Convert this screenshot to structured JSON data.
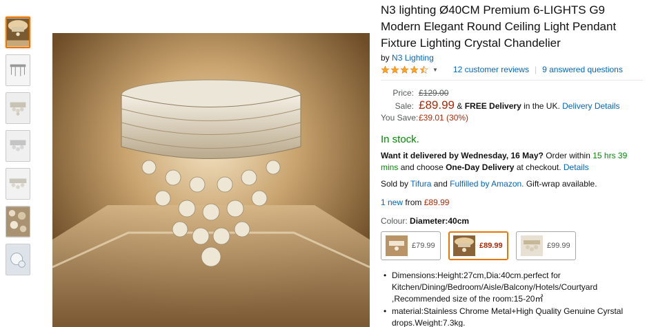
{
  "product": {
    "title": "N3 lighting Ø40CM Premium 6-LIGHTS G9 Modern Elegant Round Ceiling Light Pendant Fixture Lighting Crystal Chandelier",
    "by_label": "by",
    "brand": "N3 Lighting",
    "rating": {
      "stars": 4.5,
      "reviews_text": "12 customer reviews",
      "questions_text": "9 answered questions"
    }
  },
  "pricing": {
    "price_label": "Price:",
    "price": "£129.00",
    "sale_label": "Sale:",
    "sale_price": "£89.99",
    "delivery_prefix": "&",
    "free_delivery": "FREE Delivery",
    "delivery_suffix": "in the UK.",
    "delivery_details": "Delivery Details",
    "save_label": "You Save:",
    "save_value": "£39.01 (30%)"
  },
  "stock": "In stock.",
  "delivery_msg": {
    "want": "Want it delivered by Wednesday, 16 May?",
    "order_within": "Order within",
    "time": "15 hrs 39 mins",
    "choose": "and choose",
    "option": "One-Day Delivery",
    "at_checkout": "at checkout.",
    "details": "Details"
  },
  "seller": {
    "sold_by": "Sold by",
    "seller_name": "Tifura",
    "and": "and",
    "fulfilled": "Fulfilled by Amazon.",
    "gift": "Gift-wrap available."
  },
  "offers": {
    "new_link": "1 new",
    "from": "from",
    "price": "£89.99"
  },
  "colour": {
    "label": "Colour:",
    "selected": "Diameter:40cm",
    "options": [
      {
        "price": "£79.99"
      },
      {
        "price": "£89.99"
      },
      {
        "price": "£99.99"
      }
    ]
  },
  "bullets": [
    "Dimensions:Height:27cm,Dia:40cm.perfect for Kitchen/Dining/Bedroom/Aisle/Balcony/Hotels/Courtyard ,Recommended size of the room:15-20㎡",
    "material:Stainless Chrome Metal+High Quality Genuine Cyrstal drops.Weight:7.3kg."
  ],
  "colors": {
    "link": "#0066c0",
    "sale": "#b12704",
    "stock": "#008a00",
    "star": "#ffa41c",
    "selected_border": "#e77600"
  }
}
